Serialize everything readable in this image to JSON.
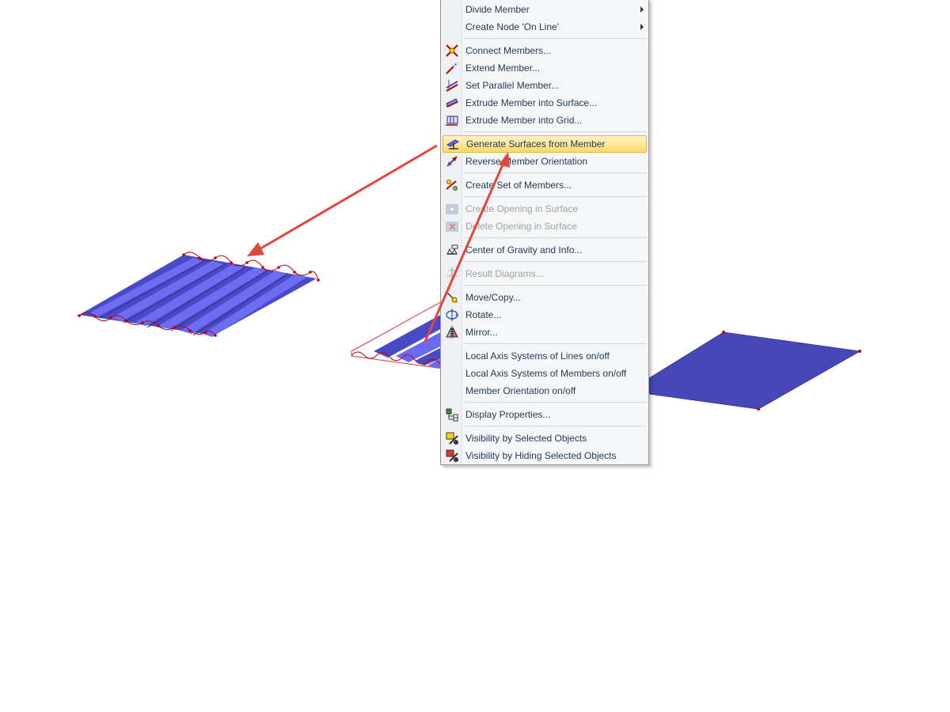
{
  "context_menu": {
    "items": [
      {
        "label": "Divide Member",
        "icon": "divide-member-icon",
        "enabled": true,
        "submenu": true
      },
      {
        "label": "Create Node 'On Line'",
        "icon": "create-node-icon",
        "enabled": true,
        "submenu": true
      },
      {
        "label": "Connect Members...",
        "icon": "connect-members-icon",
        "enabled": true
      },
      {
        "label": "Extend Member...",
        "icon": "extend-member-icon",
        "enabled": true
      },
      {
        "label": "Set Parallel Member...",
        "icon": "set-parallel-member-icon",
        "enabled": true
      },
      {
        "label": "Extrude Member into Surface...",
        "icon": "extrude-surface-icon",
        "enabled": true
      },
      {
        "label": "Extrude Member into Grid...",
        "icon": "extrude-grid-icon",
        "enabled": true
      },
      {
        "label": "Generate Surfaces from Member",
        "icon": "generate-surfaces-icon",
        "enabled": true,
        "highlighted": true
      },
      {
        "label": "Reverse Member Orientation",
        "icon": "reverse-orientation-icon",
        "enabled": true
      },
      {
        "label": "Create Set of Members...",
        "icon": "create-set-icon",
        "enabled": true
      },
      {
        "label": "Create Opening in Surface",
        "icon": "create-opening-icon",
        "enabled": false
      },
      {
        "label": "Delete Opening in Surface",
        "icon": "delete-opening-icon",
        "enabled": false
      },
      {
        "label": "Center of Gravity and Info...",
        "icon": "center-of-gravity-icon",
        "enabled": true
      },
      {
        "label": "Result Diagrams...",
        "icon": "result-diagrams-icon",
        "enabled": false
      },
      {
        "label": "Move/Copy...",
        "icon": "move-copy-icon",
        "enabled": true
      },
      {
        "label": "Rotate...",
        "icon": "rotate-icon",
        "enabled": true
      },
      {
        "label": "Mirror...",
        "icon": "mirror-icon",
        "enabled": true
      },
      {
        "label": "Local Axis Systems of Lines on/off",
        "icon": "",
        "enabled": true
      },
      {
        "label": "Local Axis Systems of Members on/off",
        "icon": "",
        "enabled": true
      },
      {
        "label": "Member Orientation on/off",
        "icon": "",
        "enabled": true
      },
      {
        "label": "Display Properties...",
        "icon": "display-properties-icon",
        "enabled": true
      },
      {
        "label": "Visibility by Selected Objects",
        "icon": "visibility-selected-icon",
        "enabled": true
      },
      {
        "label": "Visibility by Hiding Selected Objects",
        "icon": "visibility-hiding-icon",
        "enabled": true
      }
    ]
  },
  "colors": {
    "surface_blue": "#4a4ac8",
    "rib_blue": "#6a6af0",
    "node_red": "#c00000",
    "arrow_red": "#e0483e",
    "highlight_gold": "#ffd970",
    "menu_text": "#1e395b",
    "disabled_text": "#a2a2a2"
  }
}
